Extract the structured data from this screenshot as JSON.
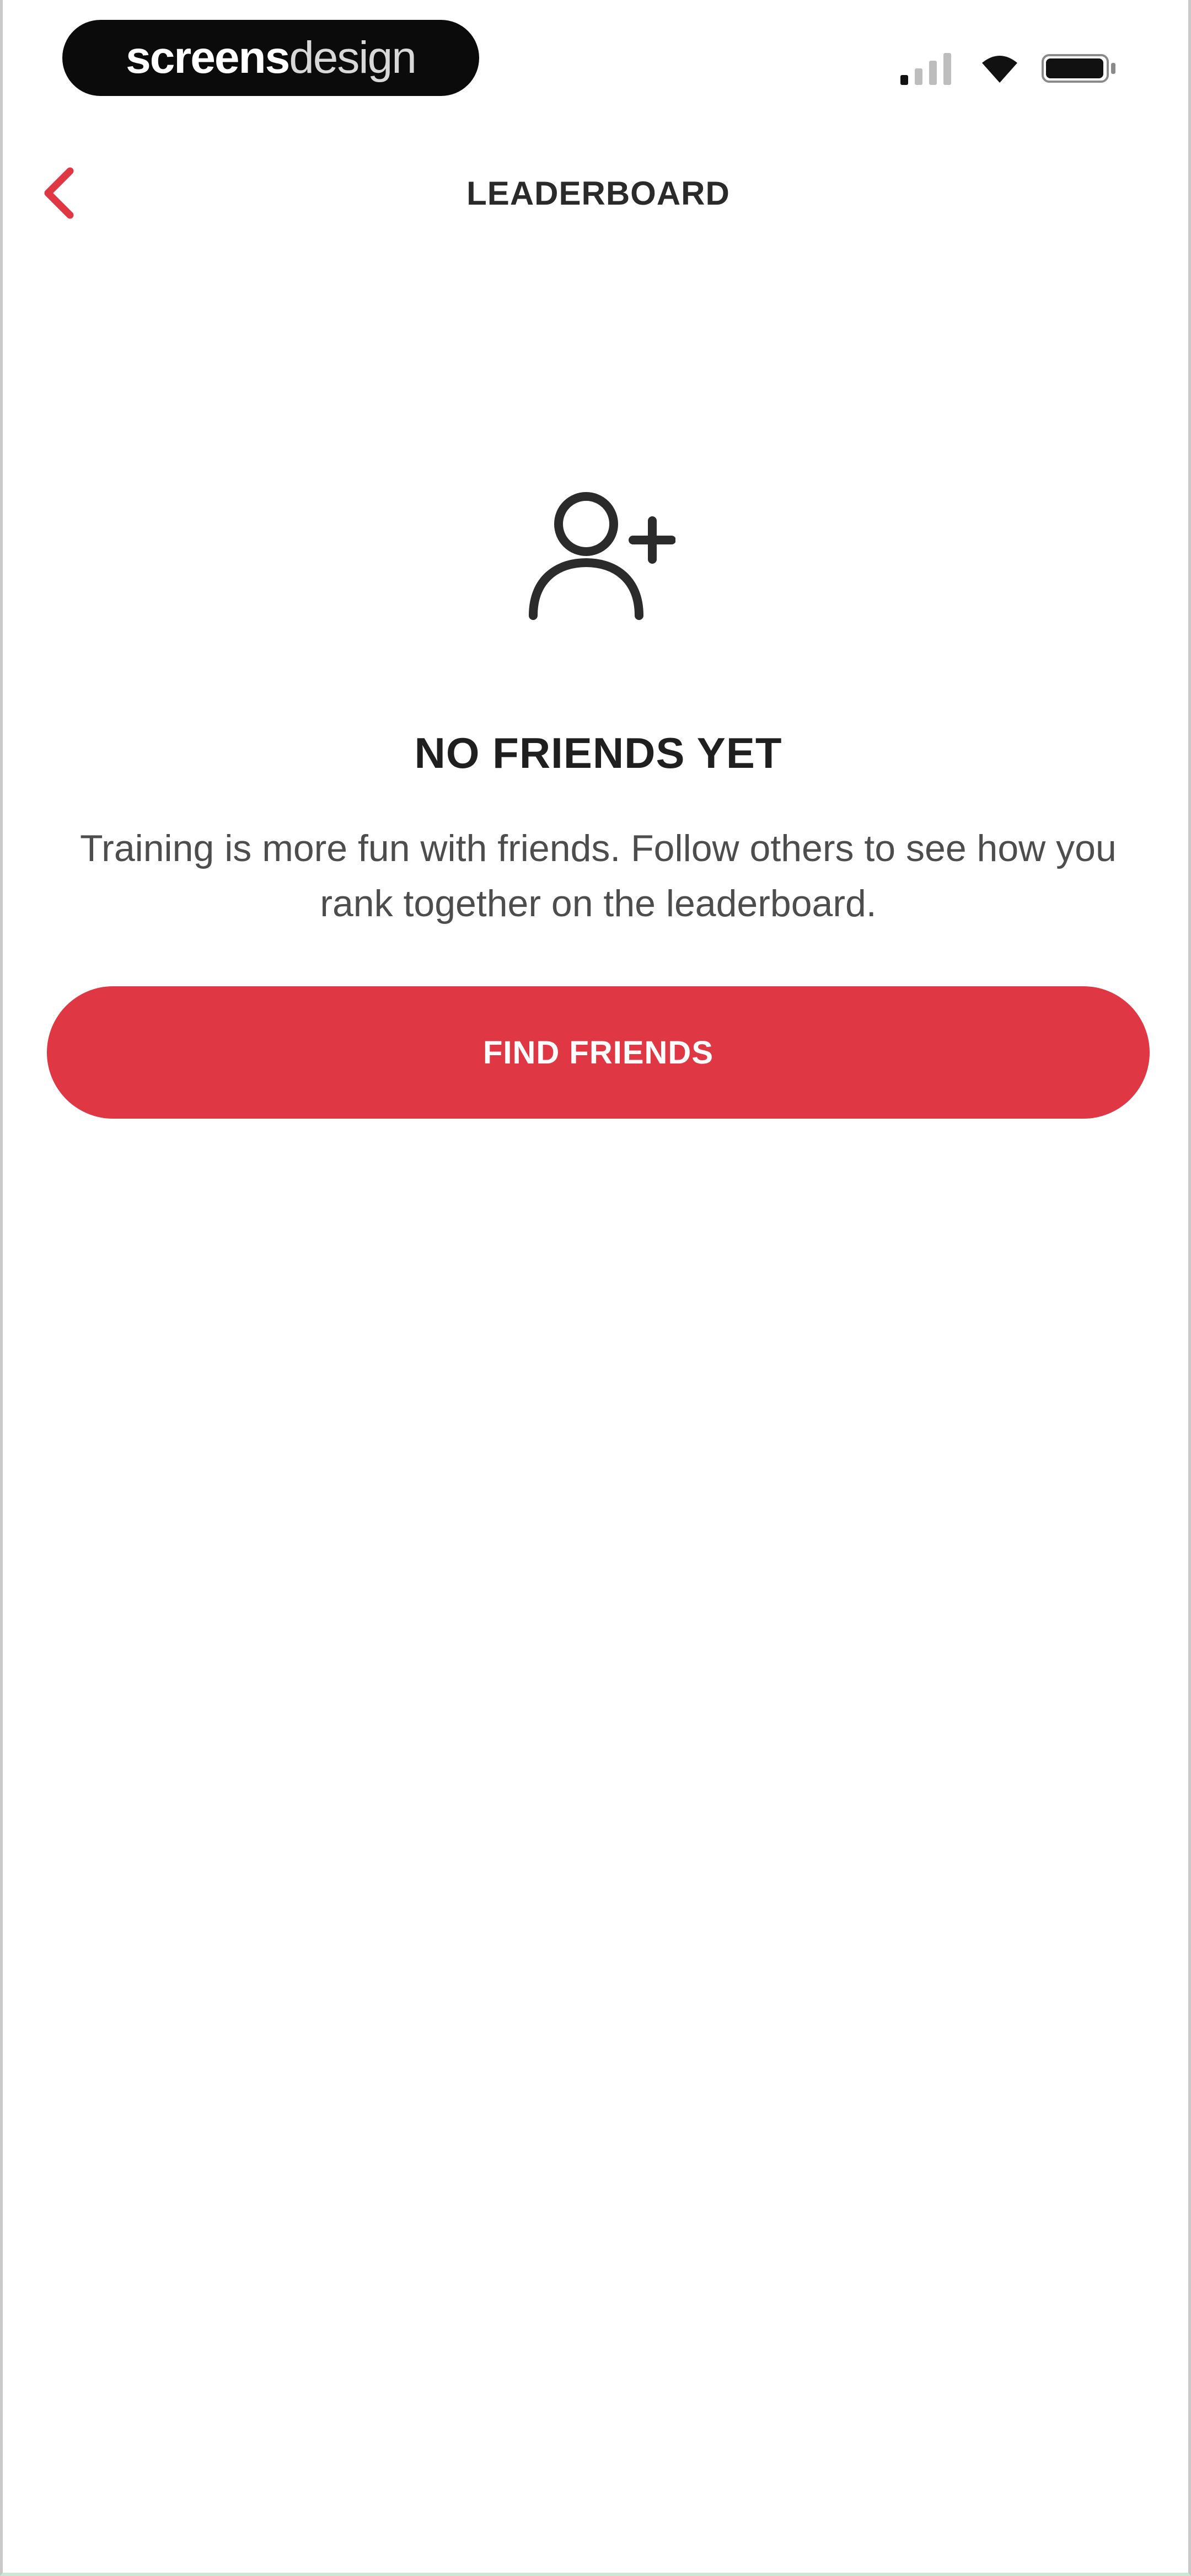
{
  "status_bar": {
    "brand_bold": "screens",
    "brand_light": "design",
    "icons": [
      "signal-icon",
      "wifi-icon",
      "battery-icon"
    ]
  },
  "header": {
    "title": "LEADERBOARD",
    "back_icon": "chevron-left-icon"
  },
  "empty_state": {
    "icon": "add-person-icon",
    "title": "NO FRIENDS YET",
    "message": "Training is more fun with friends. Follow others to see how you rank together on the leaderboard.",
    "button_label": "FIND FRIENDS"
  },
  "colors": {
    "accent": "#e03744",
    "text_dark": "#1f1f1f",
    "text_muted": "#4d4d4d",
    "background": "#ffffff"
  }
}
